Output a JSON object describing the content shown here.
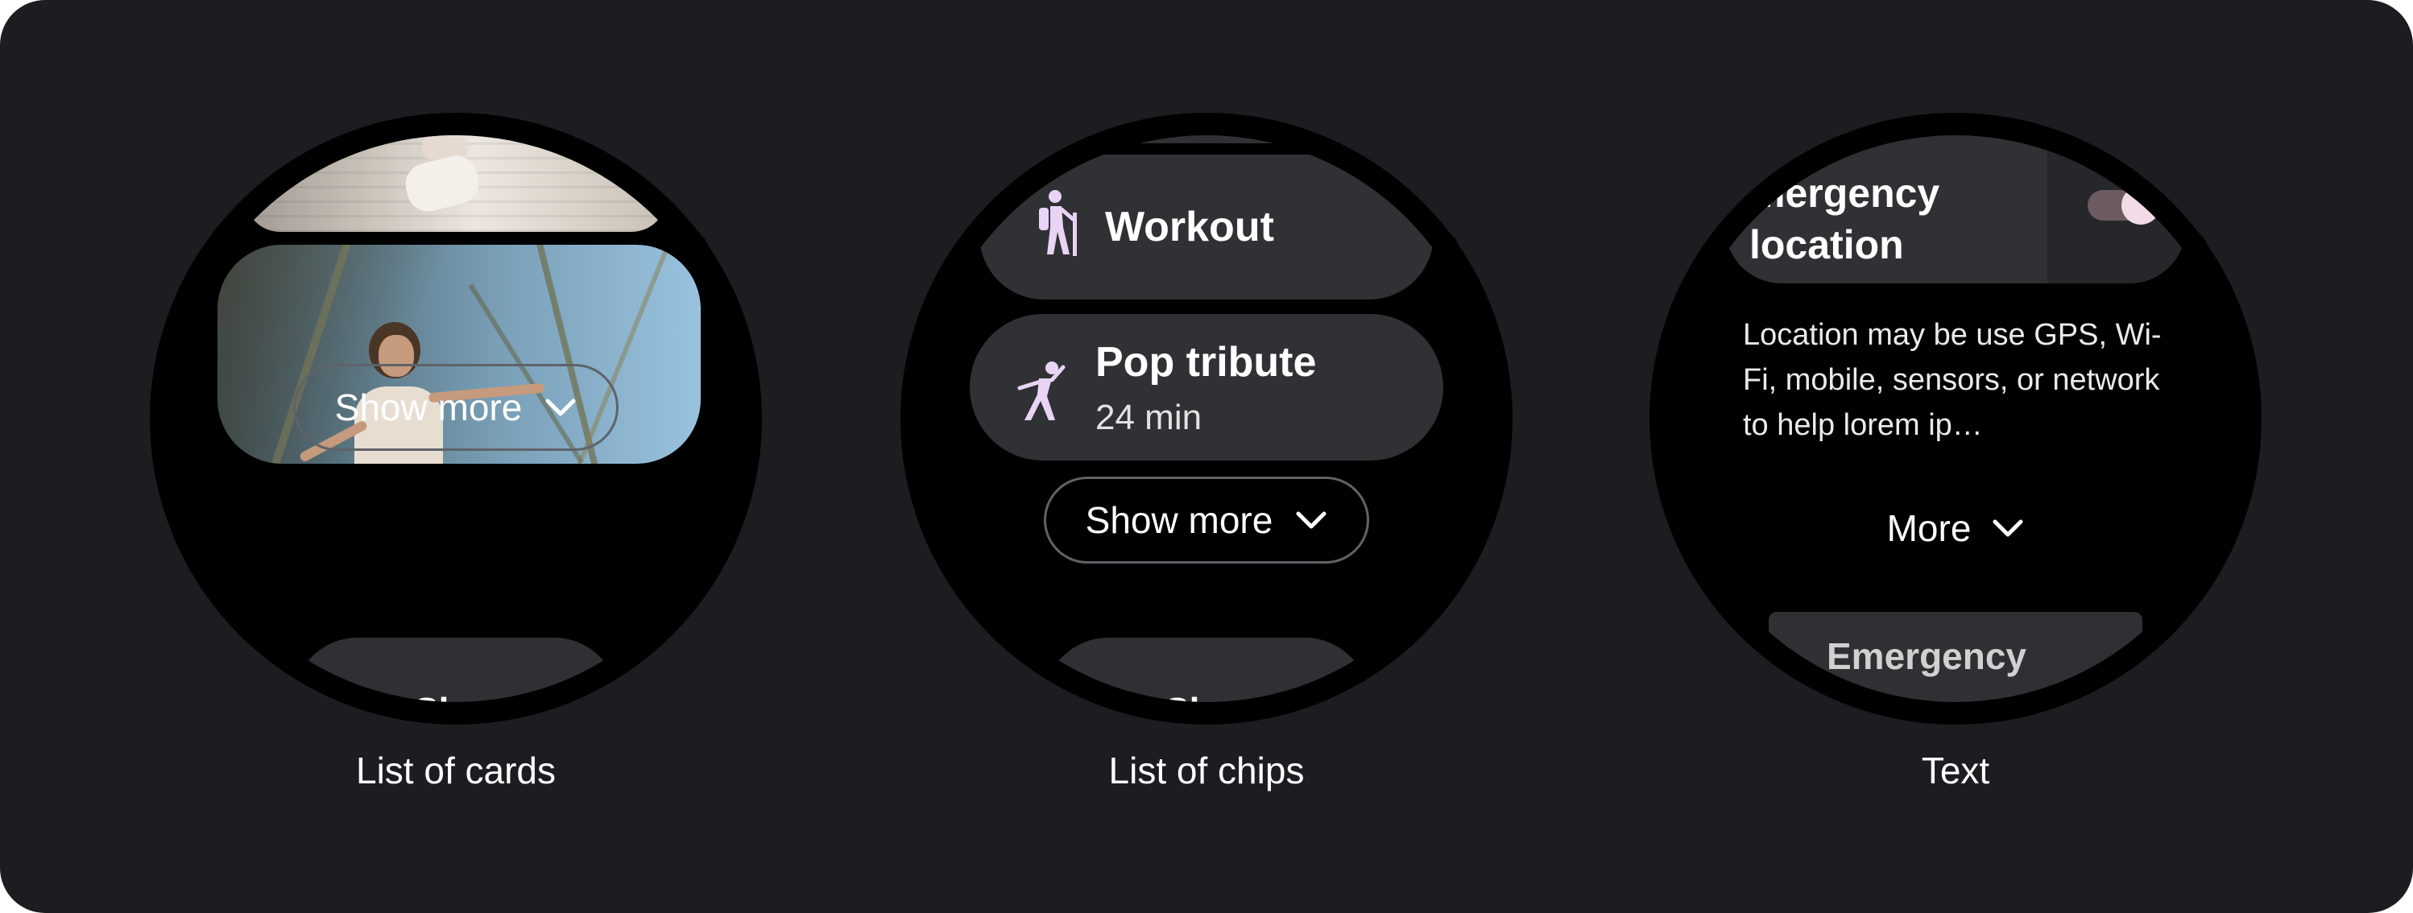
{
  "examples": [
    {
      "caption": "List of cards",
      "show_more_label": "Show more",
      "peek_text": "Sh"
    },
    {
      "caption": "List of chips",
      "chips": [
        {
          "title": "Workout",
          "icon": "hiking-person-icon"
        },
        {
          "title": "Pop tribute",
          "subtitle": "24 min",
          "icon": "dancing-person-icon"
        }
      ],
      "show_more_label": "Show more",
      "peek_text": "Sh"
    },
    {
      "caption": "Text",
      "toggle_chip": {
        "title_line1": "mergency",
        "title_line2": "location",
        "state": "on"
      },
      "body_text": "Location may be use GPS, Wi-Fi, mobile, sensors, or network to help lorem ip…",
      "more_label": "More",
      "peek_text": "Emergency"
    }
  ],
  "colors": {
    "background": "#1b1d20",
    "chip": "#303134",
    "outline": "#5f6368",
    "accent": "#e9d4f5",
    "toggle_track": "#6b5a60"
  }
}
